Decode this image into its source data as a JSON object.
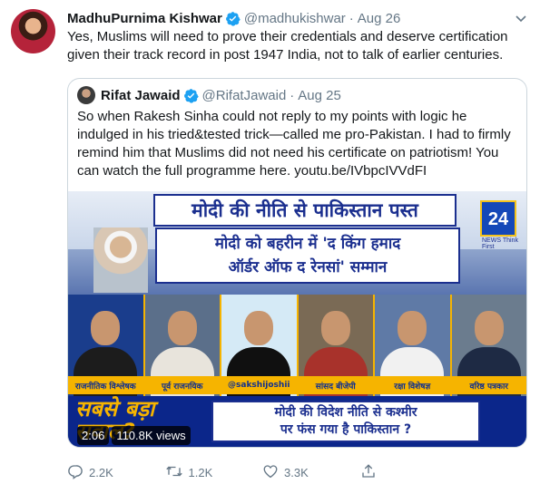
{
  "tweet": {
    "author_name": "MadhuPurnima Kishwar",
    "handle": "@madhukishwar",
    "separator": "·",
    "date": "Aug 26",
    "text": "Yes, Muslims will need to prove their credentials and deserve certification given their track record in post 1947 India, not to talk of earlier centuries."
  },
  "quote": {
    "author_name": "Rifat Jawaid",
    "handle": "@RifatJawaid",
    "separator": "·",
    "date": "Aug 25",
    "text": "So when Rakesh Sinha could not reply to my points with logic he indulged in his tried&tested trick—called me pro-Pakistan. I had to firmly remind him that Muslims did not need his certificate on patriotism! You can watch the full programme here. youtu.be/IVbpcIVVdFI"
  },
  "video": {
    "banner_title": "मोदी की नीति से पाकिस्तान पस्त",
    "banner_line1": "मोदी को बहरीन में 'द किंग हमाद",
    "banner_line2": "ऑर्डर ऑफ द रेनसां' सम्मान",
    "channel_logo": "24",
    "channel_tag": "NEWS",
    "channel_sub": "Think First",
    "panelists": [
      {
        "caption": "राजनीतिक विश्लेषक",
        "bg": "#1a3d8c",
        "shirt": "#1c1c1c"
      },
      {
        "caption": "पूर्व राजनयिक",
        "bg": "#5b6f8a",
        "shirt": "#e8e4dc"
      },
      {
        "caption": "@sakshijoshii",
        "bg": "#d5eaf6",
        "shirt": "#101010"
      },
      {
        "caption": "सांसद बीजेपी",
        "bg": "#7a6a55",
        "shirt": "#a8322b"
      },
      {
        "caption": "रक्षा विशेषज्ञ",
        "bg": "#5f7aa6",
        "shirt": "#f1f1f1"
      },
      {
        "caption": "वरिष्ठ पत्रकार",
        "bg": "#6b7c8e",
        "shirt": "#1e2a44"
      }
    ],
    "segment_line1": "सबसे बड़ा",
    "segment_line2": "सवाल?",
    "ticker_line1": "मोदी की विदेश नीति से कश्मीर",
    "ticker_line2": "पर फंस गया है पाकिस्तान ?",
    "duration": "2:06",
    "views": "110.8K views"
  },
  "actions": {
    "replies": "2.2K",
    "retweets": "1.2K",
    "likes": "3.3K"
  },
  "colors": {
    "verified": "#1da1f2",
    "muted": "#657786",
    "border": "#ccd6dd"
  }
}
